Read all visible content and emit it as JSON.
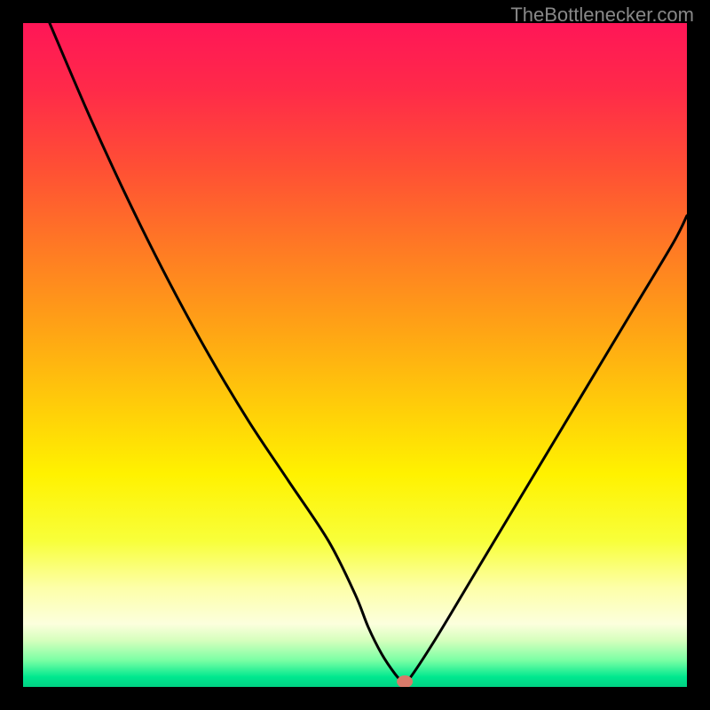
{
  "watermark": "TheBottlenecker.com",
  "chart_data": {
    "type": "line",
    "title": "",
    "xlabel": "",
    "ylabel": "",
    "xlim": [
      0,
      100
    ],
    "ylim": [
      0,
      100
    ],
    "background": "rainbow-vertical",
    "series": [
      {
        "name": "curve",
        "x": [
          4,
          10,
          16,
          22,
          28,
          34,
          40,
          46,
          50,
          52,
          54,
          56,
          57,
          58,
          62,
          68,
          74,
          80,
          86,
          92,
          98,
          100
        ],
        "y": [
          100,
          86,
          73,
          61,
          50,
          40,
          31,
          22,
          14,
          9,
          5,
          2,
          1,
          1,
          7,
          17,
          27,
          37,
          47,
          57,
          67,
          71
        ]
      }
    ],
    "marker": {
      "x": 57.5,
      "y": 0.8,
      "color": "#d97a6a"
    },
    "gradient_stops": [
      {
        "offset": 0.0,
        "color": "#ff1657"
      },
      {
        "offset": 0.1,
        "color": "#ff2a49"
      },
      {
        "offset": 0.22,
        "color": "#ff5034"
      },
      {
        "offset": 0.34,
        "color": "#ff7a24"
      },
      {
        "offset": 0.46,
        "color": "#ffa315"
      },
      {
        "offset": 0.58,
        "color": "#ffce09"
      },
      {
        "offset": 0.68,
        "color": "#fff200"
      },
      {
        "offset": 0.78,
        "color": "#f8ff3a"
      },
      {
        "offset": 0.85,
        "color": "#fdffa8"
      },
      {
        "offset": 0.905,
        "color": "#fcffdd"
      },
      {
        "offset": 0.93,
        "color": "#d6ffbd"
      },
      {
        "offset": 0.96,
        "color": "#7affa4"
      },
      {
        "offset": 0.985,
        "color": "#00e88f"
      },
      {
        "offset": 1.0,
        "color": "#00d184"
      }
    ]
  }
}
